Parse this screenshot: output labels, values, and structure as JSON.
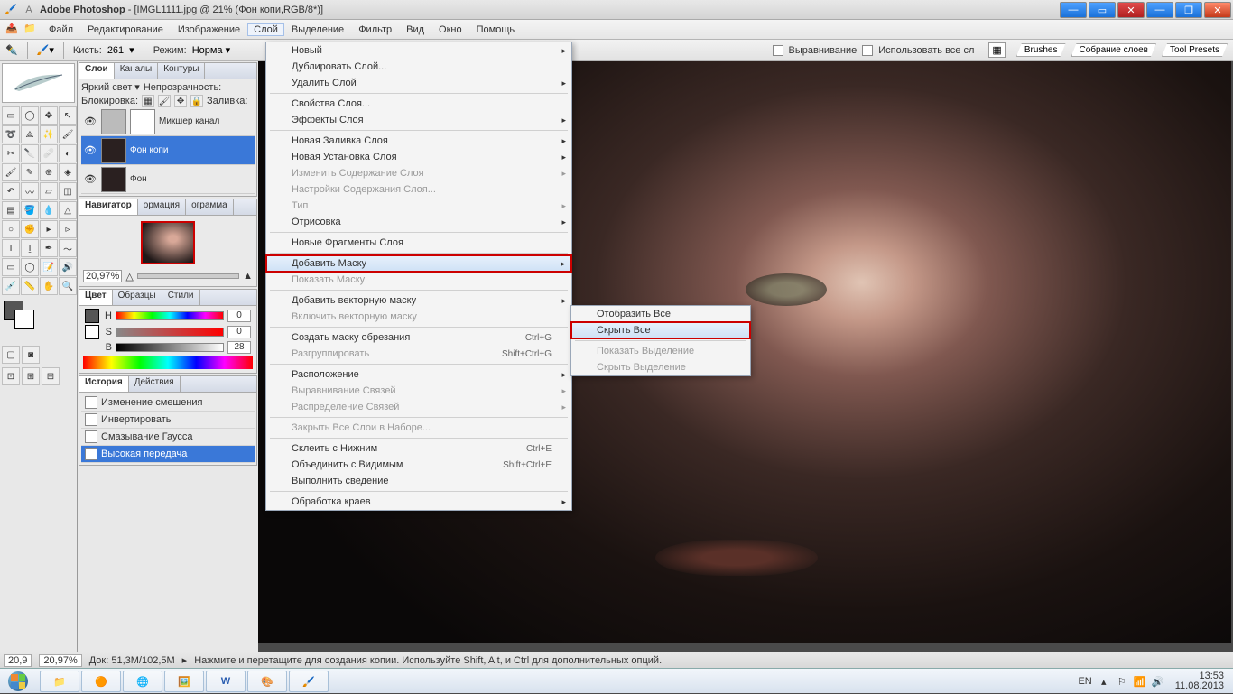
{
  "titlebar": {
    "app": "Adobe Photoshop",
    "doc": "[IMGL1111.jpg @ 21% (Фон копи,RGB/8*)]"
  },
  "menubar": {
    "items": [
      "Файл",
      "Редактирование",
      "Изображение",
      "Слой",
      "Выделение",
      "Фильтр",
      "Вид",
      "Окно",
      "Помощь"
    ]
  },
  "optionbar": {
    "brush_label": "Кисть:",
    "brush_size": "261",
    "mode_label": "Режим:",
    "mode_value": "Норма",
    "align_label": "Выравнивание",
    "useall_label": "Использовать все сл"
  },
  "tabs": [
    "Brushes",
    "Собрание слоев",
    "Tool Presets"
  ],
  "layers_panel": {
    "tabs": [
      "Слои",
      "Каналы",
      "Контуры"
    ],
    "blend_label": "Яркий свет",
    "opacity_label": "Непрозрачность:",
    "lock_label": "Блокировка:",
    "fill_label": "Заливка:",
    "rows": [
      {
        "name": "Микшер канал",
        "kind": "mixer"
      },
      {
        "name": "Фон копи",
        "selected": true
      },
      {
        "name": "Фон"
      }
    ]
  },
  "navigator": {
    "tabs": [
      "Навигатор",
      "ормация",
      "ограмма"
    ],
    "zoom": "20,97%"
  },
  "color_panel": {
    "tabs": [
      "Цвет",
      "Образцы",
      "Стили"
    ],
    "h": {
      "k": "H",
      "v": "0"
    },
    "s": {
      "k": "S",
      "v": "0"
    },
    "b": {
      "k": "B",
      "v": "28"
    }
  },
  "history_panel": {
    "tabs": [
      "История",
      "Действия"
    ],
    "rows": [
      "Изменение смешения",
      "Инвертировать",
      "Смазывание Гаусса",
      "Высокая передача"
    ]
  },
  "menu_layer": [
    {
      "t": "Новый",
      "arrow": true
    },
    {
      "t": "Дублировать Слой..."
    },
    {
      "t": "Удалить Слой",
      "arrow": true
    },
    {
      "sep": true
    },
    {
      "t": "Свойства Слоя..."
    },
    {
      "t": "Эффекты Слоя",
      "arrow": true
    },
    {
      "sep": true
    },
    {
      "t": "Новая Заливка Слоя",
      "arrow": true
    },
    {
      "t": "Новая Установка Слоя",
      "arrow": true
    },
    {
      "t": "Изменить Содержание Слоя",
      "arrow": true,
      "disabled": true
    },
    {
      "t": "Настройки Содержания Слоя...",
      "disabled": true
    },
    {
      "t": "Тип",
      "arrow": true,
      "disabled": true
    },
    {
      "t": "Отрисовка",
      "arrow": true
    },
    {
      "sep": true
    },
    {
      "t": "Новые Фрагменты Слоя"
    },
    {
      "sep": true
    },
    {
      "t": "Добавить Маску",
      "arrow": true,
      "hover": true,
      "red": true
    },
    {
      "t": "Показать Маску",
      "disabled": true
    },
    {
      "sep": true
    },
    {
      "t": "Добавить векторную маску",
      "arrow": true
    },
    {
      "t": "Включить векторную маску",
      "disabled": true
    },
    {
      "sep": true
    },
    {
      "t": "Создать маску обрезания",
      "sc": "Ctrl+G"
    },
    {
      "t": "Разгруппировать",
      "sc": "Shift+Ctrl+G",
      "disabled": true
    },
    {
      "sep": true
    },
    {
      "t": "Расположение",
      "arrow": true
    },
    {
      "t": "Выравнивание Связей",
      "arrow": true,
      "disabled": true
    },
    {
      "t": "Распределение Связей",
      "arrow": true,
      "disabled": true
    },
    {
      "sep": true
    },
    {
      "t": "Закрыть Все Слои в Наборе...",
      "disabled": true
    },
    {
      "sep": true
    },
    {
      "t": "Склеить с Нижним",
      "sc": "Ctrl+E"
    },
    {
      "t": "Объединить с Видимым",
      "sc": "Shift+Ctrl+E"
    },
    {
      "t": "Выполнить сведение"
    },
    {
      "sep": true
    },
    {
      "t": "Обработка краев",
      "arrow": true
    }
  ],
  "submenu_mask": [
    {
      "t": "Отобразить Все"
    },
    {
      "t": "Скрыть Все",
      "hover": true,
      "red": true
    },
    {
      "sep": true
    },
    {
      "t": "Показать Выделение",
      "disabled": true
    },
    {
      "t": "Скрыть Выделение",
      "disabled": true
    }
  ],
  "statusbar": {
    "zoom1": "20,9",
    "zoom2": "20,97%",
    "docsize": "Док: 51,3M/102,5M",
    "hint": "Нажмите и перетащите для создания копии.  Используйте Shift, Alt, и Ctrl для дополнительных опций."
  },
  "tray": {
    "lang": "EN",
    "time": "13:53",
    "date": "11.08.2013"
  }
}
